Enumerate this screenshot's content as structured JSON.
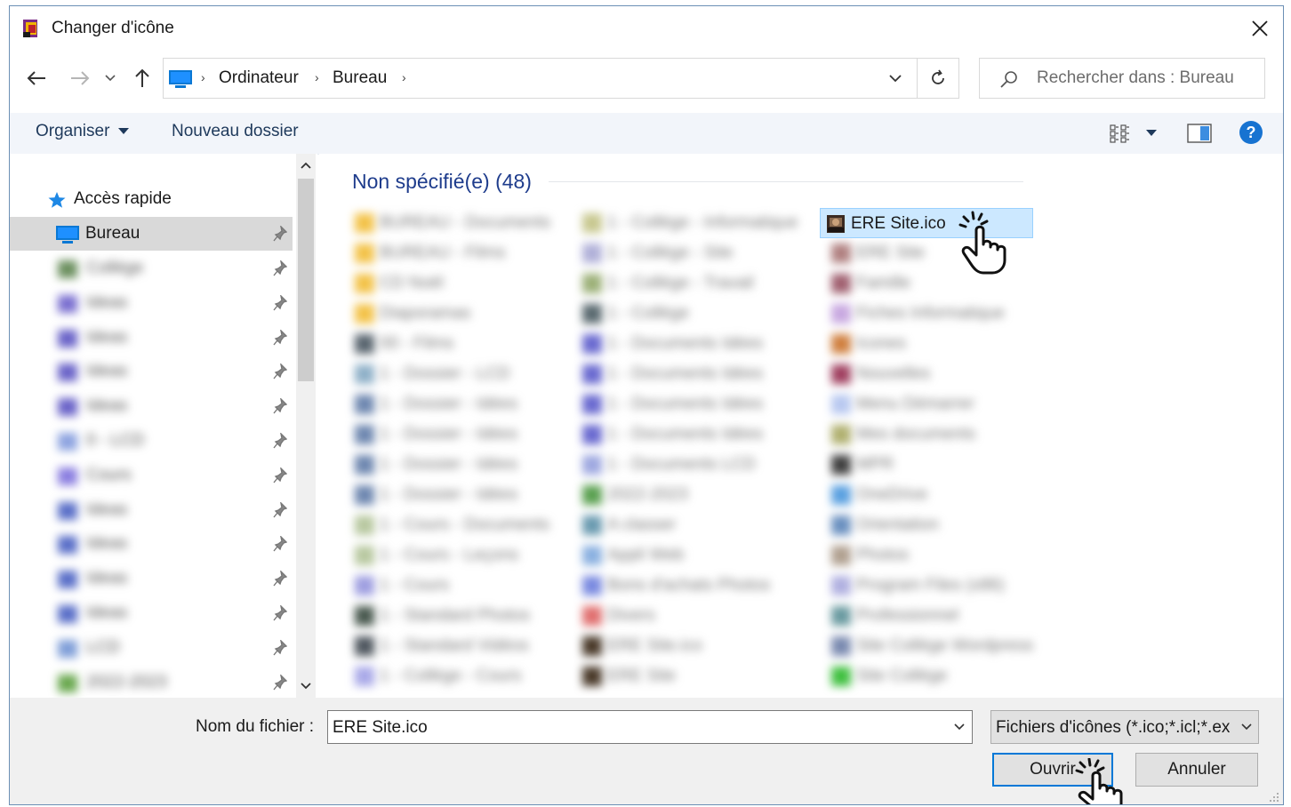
{
  "window": {
    "title": "Changer d'icône"
  },
  "address": {
    "crumbs": [
      "Ordinateur",
      "Bureau"
    ],
    "separator": "›"
  },
  "search": {
    "placeholder": "Rechercher dans : Bureau"
  },
  "toolbar": {
    "organize_label": "Organiser",
    "new_folder_label": "Nouveau dossier"
  },
  "nav": {
    "quick_access_label": "Accès rapide",
    "selected_label": "Bureau",
    "blurred_items": [
      "Collège",
      "Ideas",
      "Ideas",
      "Ideas",
      "Ideas",
      "0 - LCD",
      "Cours",
      "Ideas",
      "Ideas",
      "Ideas",
      "Ideas",
      "LCD",
      "2022-2023"
    ]
  },
  "content": {
    "group_header": "Non spécifié(e) (48)",
    "selected_file": "ERE Site.ico",
    "blurred_col1": [
      "BUREAU - Documents",
      "BUREAU - Films",
      "CD Noël",
      "Diaporamas",
      "00 - Films",
      "1 - Dossier - LCD",
      "1 - Dossier - Idées",
      "1 - Dossier - Idées",
      "1 - Dossier - Idées",
      "1 - Dossier - Idées",
      "1 - Cours - Documents",
      "1 - Cours - Leçons",
      "1 - Cours",
      "1 - Standard Photos",
      "1 - Standard Vidéos",
      "1 - Collège - Cours"
    ],
    "blurred_col2": [
      "1 - Collège - Informatique",
      "1 - Collège - Site",
      "1 - Collège - Travail",
      "1 - Collège",
      "1 - Documents Idées",
      "1 - Documents Idées",
      "1 - Documents Idées",
      "1 - Documents Idées",
      "1 - Documents LCD",
      "2022-2023",
      "A classer",
      "Appli Web",
      "Bons d'achats Photos",
      "Divers",
      "ERE Site.ico",
      "ERE Site"
    ],
    "blurred_col3": [
      "ERE Site",
      "Famille",
      "Fiches Informatique",
      "Icones",
      "Nouvelles",
      "Menu Démarrer",
      "Mes documents",
      "MPR",
      "OneDrive",
      "Orientation",
      "Photos",
      "Program Files (x86)",
      "Professionnel",
      "Site Collège Wordpress",
      "Site Collège"
    ]
  },
  "footer": {
    "filename_label": "Nom du fichier :",
    "filename_value": "ERE Site.ico",
    "filter_value": "Fichiers d'icônes (*.ico;*.icl;*.ex",
    "open_label": "Ouvrir",
    "cancel_label": "Annuler"
  },
  "icons": {
    "back": "arrow-left-icon",
    "forward": "arrow-right-icon",
    "recent": "chevron-down-icon",
    "up": "arrow-up-icon",
    "refresh": "refresh-icon",
    "search": "search-icon",
    "help": "help-icon"
  },
  "colors": {
    "accent": "#0078d7",
    "header_blue": "#1e3c8c",
    "selection": "#cce8ff"
  }
}
